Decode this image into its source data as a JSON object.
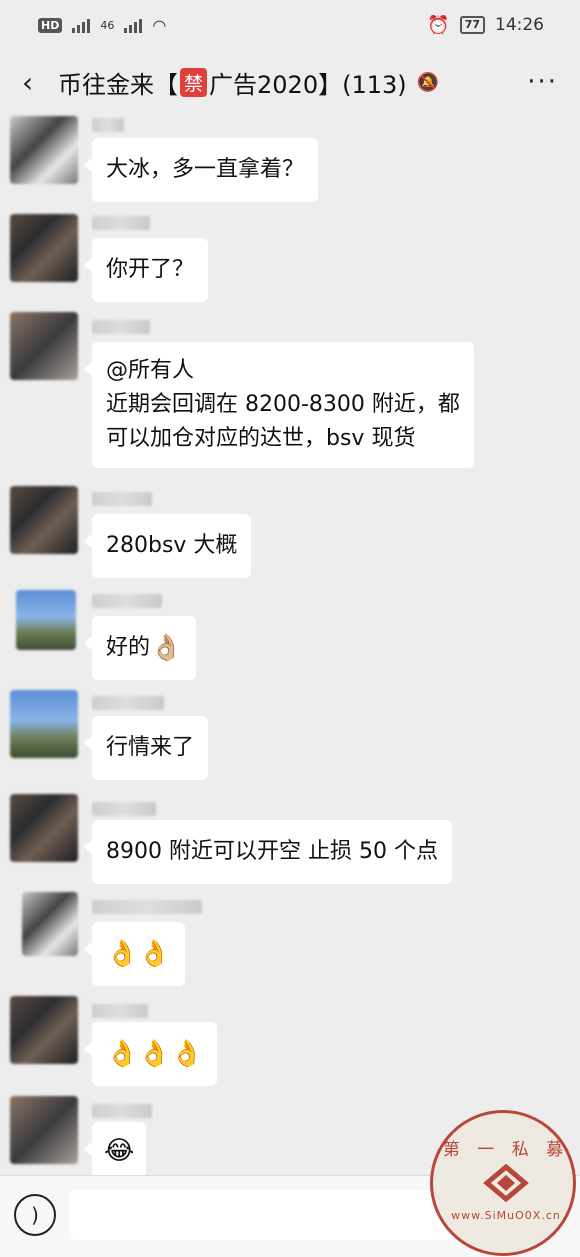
{
  "status_bar": {
    "network": "HD",
    "sim": "2",
    "signal_label": "46",
    "battery": "77",
    "time": "14:26",
    "icons": [
      "hd-icon",
      "signal-icon",
      "wifi-icon",
      "alarm-icon",
      "battery-icon"
    ]
  },
  "nav": {
    "title_prefix": "币往金来【",
    "ban_tag": "禁",
    "title_suffix": "广告2020】(113)",
    "icons": [
      "back-icon",
      "mute-icon",
      "more-icon"
    ]
  },
  "messages": [
    {
      "text": "大冰，多一直拿着？"
    },
    {
      "text": "你开了？"
    },
    {
      "lines": [
        "@所有人",
        "近期会回调在 8200-8300 附近，都",
        "可以加仓对应的达世，bsv 现货"
      ]
    },
    {
      "text": "280bsv 大概"
    },
    {
      "text": "好的",
      "emoji": "👌🏼"
    },
    {
      "text": "行情来了"
    },
    {
      "text": "8900 附近可以开空 止损 50 个点"
    },
    {
      "text": "",
      "emoji": "👌👌"
    },
    {
      "text": "",
      "emoji": "👌👌👌"
    },
    {
      "text": "",
      "emoji": "😂"
    }
  ],
  "input_bar": {
    "icons": [
      "voice-icon"
    ]
  },
  "watermark": {
    "text": "第 一 私 募",
    "url": "www.SiMuO0X.cn"
  }
}
